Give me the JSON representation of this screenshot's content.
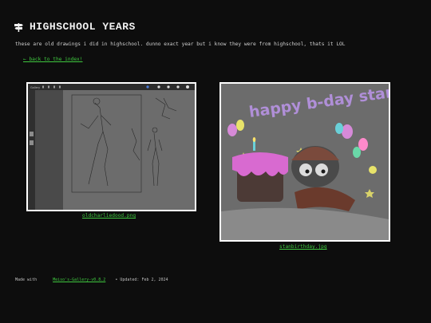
{
  "header": {
    "title": "HIGHSCHOOL YEARS",
    "icon": "signpost-icon",
    "description": "these are old drawings i did in highschool. dunno exact year but i know they were from highschool, thats it LOL"
  },
  "nav": {
    "back_label": "← back to the index!"
  },
  "gallery": {
    "items": [
      {
        "caption": "oldcharliedood.png",
        "app_menu_label": "Gallery"
      },
      {
        "caption": "stanbirthday.jpg",
        "banner_text": "happy b-day stan!"
      }
    ]
  },
  "footer": {
    "made_with": "Made with",
    "generator_link": "Meiso's-Gallery-v0.8.2",
    "updated": "• Updated: Feb 2, 2024"
  },
  "colors": {
    "background": "#0d0d0d",
    "link": "#3fc83f",
    "text": "#d6d6d6"
  }
}
